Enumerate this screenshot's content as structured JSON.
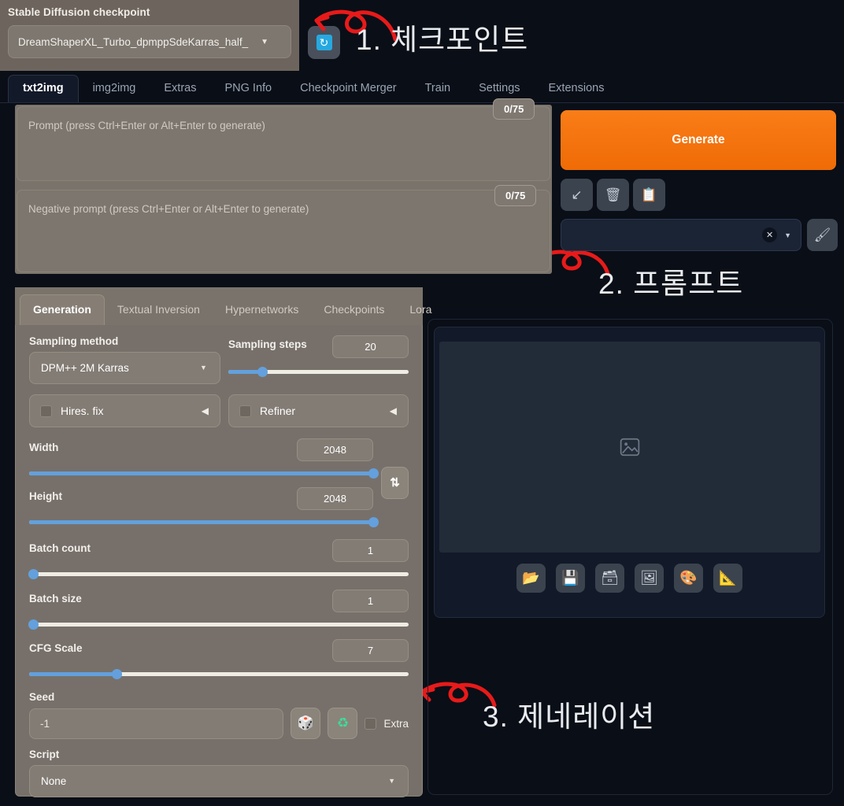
{
  "checkpoint": {
    "label": "Stable Diffusion checkpoint",
    "value": "DreamShaperXL_Turbo_dpmppSdeKarras_half_",
    "caret": "▼",
    "refresh_icon": "↻"
  },
  "annotations": [
    {
      "id": 1,
      "text": "1. 체크포인트"
    },
    {
      "id": 2,
      "text": "2. 프롬프트"
    },
    {
      "id": 3,
      "text": "3. 제네레이션"
    }
  ],
  "top_tabs": [
    {
      "label": "txt2img",
      "active": true
    },
    {
      "label": "img2img",
      "active": false
    },
    {
      "label": "Extras",
      "active": false
    },
    {
      "label": "PNG Info",
      "active": false
    },
    {
      "label": "Checkpoint Merger",
      "active": false
    },
    {
      "label": "Train",
      "active": false
    },
    {
      "label": "Settings",
      "active": false
    },
    {
      "label": "Extensions",
      "active": false
    }
  ],
  "prompt": {
    "positive_placeholder": "Prompt (press Ctrl+Enter or Alt+Enter to generate)",
    "positive_value": "",
    "positive_tokens": "0/75",
    "negative_placeholder": "Negative prompt (press Ctrl+Enter or Alt+Enter to generate)",
    "negative_value": "",
    "negative_tokens": "0/75"
  },
  "generate": {
    "button_label": "Generate",
    "accent_color": "#f5760c",
    "tools": [
      {
        "name": "arrow-down-left-icon",
        "glyph": "↙"
      },
      {
        "name": "trash-icon",
        "glyph": "🗑"
      },
      {
        "name": "clipboard-icon",
        "glyph": "📋"
      }
    ],
    "styles_value": "",
    "styles_clear_glyph": "✕",
    "styles_caret": "▼",
    "paintbrush_glyph": "🖌"
  },
  "gen_tabs": [
    {
      "label": "Generation",
      "active": true
    },
    {
      "label": "Textual Inversion",
      "active": false
    },
    {
      "label": "Hypernetworks",
      "active": false
    },
    {
      "label": "Checkpoints",
      "active": false
    },
    {
      "label": "Lora",
      "active": false
    }
  ],
  "generation": {
    "sampling_method_label": "Sampling method",
    "sampling_method_value": "DPM++ 2M Karras",
    "sampling_steps_label": "Sampling steps",
    "sampling_steps_value": "20",
    "sampling_steps_pct": 19,
    "hires_fix_label": "Hires. fix",
    "refiner_label": "Refiner",
    "width_label": "Width",
    "width_value": "2048",
    "width_pct": 100,
    "height_label": "Height",
    "height_value": "2048",
    "height_pct": 100,
    "swap_glyph": "⇅",
    "batch_count_label": "Batch count",
    "batch_count_value": "1",
    "batch_count_pct": 0,
    "batch_size_label": "Batch size",
    "batch_size_value": "1",
    "batch_size_pct": 0,
    "cfg_scale_label": "CFG Scale",
    "cfg_scale_value": "7",
    "cfg_scale_pct": 23,
    "seed_label": "Seed",
    "seed_value": "-1",
    "dice_glyph": "🎲",
    "recycle_glyph": "♻",
    "extra_label": "Extra",
    "script_label": "Script",
    "script_value": "None",
    "caret": "▼",
    "triangle": "◀"
  },
  "preview": {
    "placeholder_icon": "image-placeholder-icon",
    "toolbar": [
      {
        "name": "open-folder-icon",
        "glyph": "📂"
      },
      {
        "name": "save-icon",
        "glyph": "💾"
      },
      {
        "name": "zip-archive-icon",
        "glyph": "🗃"
      },
      {
        "name": "send-to-img2img-icon",
        "glyph": "🖼"
      },
      {
        "name": "send-to-inpaint-icon",
        "glyph": "🎨"
      },
      {
        "name": "send-to-extras-icon",
        "glyph": "📐"
      }
    ]
  }
}
